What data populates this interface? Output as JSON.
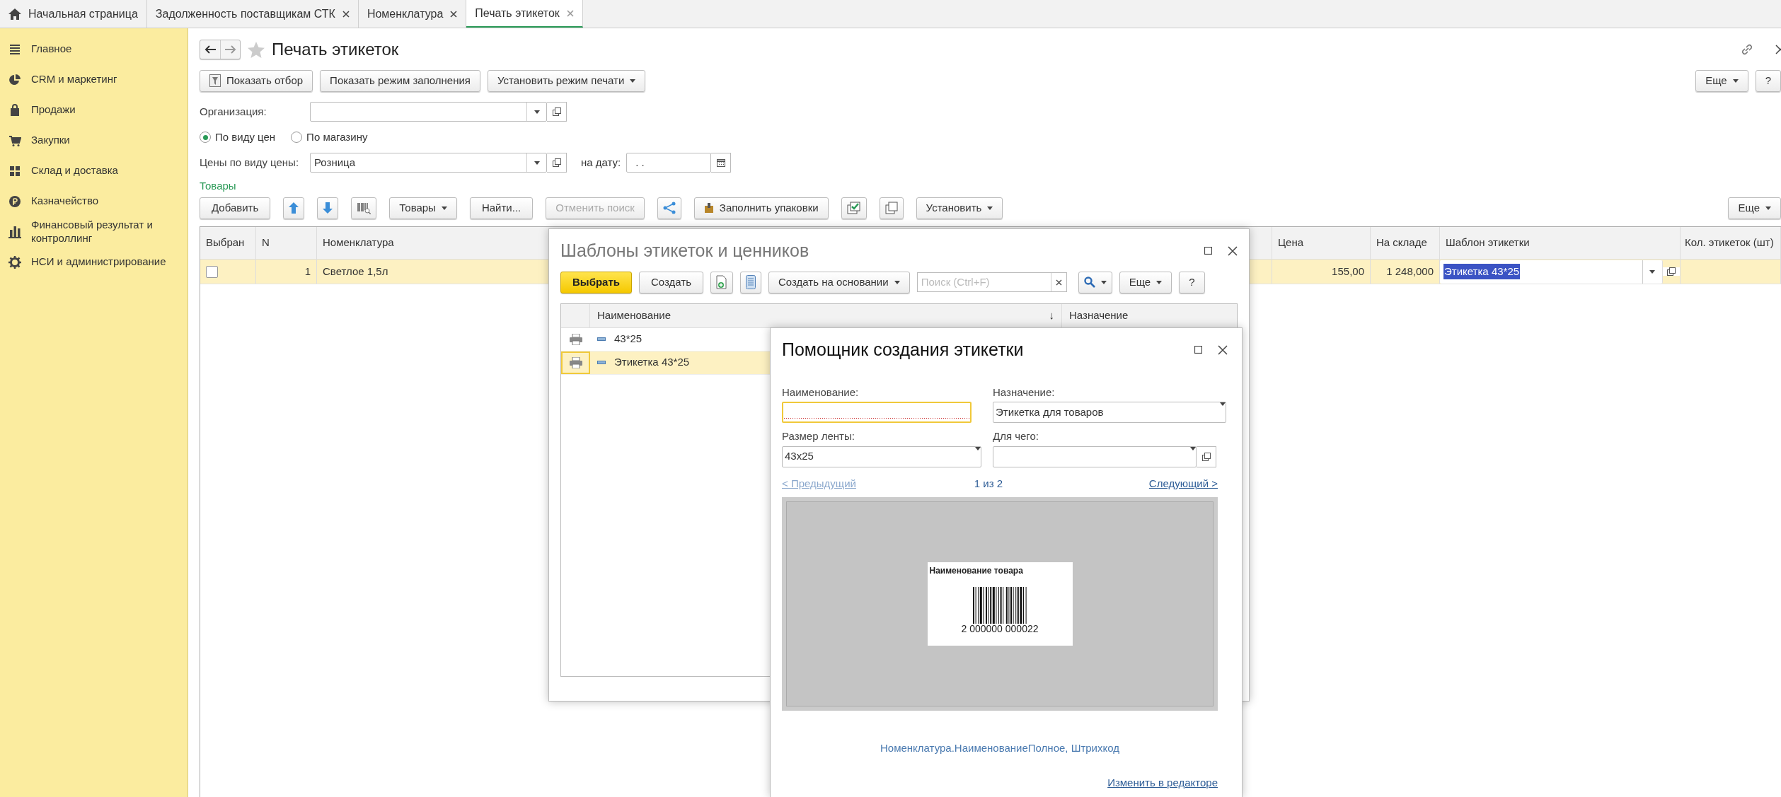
{
  "tabs": [
    {
      "label": "Начальная страница",
      "kind": "home",
      "selected": false
    },
    {
      "label": "Задолженность поставщикам СТК",
      "kind": "closable",
      "selected": false
    },
    {
      "label": "Номенклатура",
      "kind": "closable",
      "selected": false
    },
    {
      "label": "Печать этикеток",
      "kind": "closable",
      "selected": true
    }
  ],
  "sidebar": {
    "items": [
      {
        "label": "Главное"
      },
      {
        "label": "CRM и маркетинг"
      },
      {
        "label": "Продажи"
      },
      {
        "label": "Закупки"
      },
      {
        "label": "Склад и доставка"
      },
      {
        "label": "Казначейство"
      },
      {
        "label": "Финансовый результат и контроллинг"
      },
      {
        "label": "НСИ и администрирование"
      }
    ]
  },
  "form": {
    "title": "Печать этикеток",
    "toolbar": [
      {
        "kind": "icon",
        "label": "Показать отбор"
      },
      {
        "kind": "plain",
        "label": "Показать режим заполнения"
      },
      {
        "kind": "dropdown",
        "label": "Установить режим печати"
      }
    ],
    "more": "Еще",
    "help": "?",
    "organization": {
      "label": "Организация:"
    },
    "price_mode": [
      {
        "label": "По виду цен",
        "selected": true
      },
      {
        "label": "По магазину",
        "selected": false
      }
    ],
    "price_type": {
      "label": "Цены по виду цены:",
      "value": "Розница"
    },
    "date": {
      "label": "на дату:",
      "value": ". ."
    },
    "section": "Товары",
    "items_toolbar": [
      {
        "kind": "button",
        "label": "Добавить",
        "disabled": false
      },
      {
        "kind": "up",
        "disabled": false
      },
      {
        "kind": "down",
        "disabled": false
      },
      {
        "kind": "barcode",
        "disabled": false
      },
      {
        "kind": "dropdown",
        "label": "Товары",
        "disabled": false
      },
      {
        "kind": "button",
        "label": "Найти...",
        "disabled": false
      },
      {
        "kind": "button",
        "label": "Отменить поиск",
        "disabled": true
      },
      {
        "kind": "share",
        "disabled": false
      },
      {
        "kind": "package",
        "label": "Заполнить упаковки",
        "disabled": false
      },
      {
        "kind": "check",
        "disabled": false
      },
      {
        "kind": "copy",
        "disabled": false
      },
      {
        "kind": "dropdown",
        "label": "Установить",
        "disabled": false
      }
    ],
    "items_more": "Еще",
    "table": {
      "columns": [
        {
          "label": "Выбран"
        },
        {
          "label": "N"
        },
        {
          "label": "Номенклатура"
        },
        {
          "label": "Цена"
        },
        {
          "label": "На складе"
        },
        {
          "label": "Шаблон этикетки"
        },
        {
          "label": "Кол. этикеток (шт)"
        }
      ],
      "rows": [
        {
          "checked": false,
          "n": "1",
          "name": "Светлое 1,5л",
          "price": "155,00",
          "stock": "1 248,000",
          "template": "Этикетка 43*25",
          "selected": true
        }
      ]
    }
  },
  "templates_dialog": {
    "title": "Шаблоны этикеток и ценников",
    "toolbar": [
      {
        "kind": "primary",
        "label": "Выбрать"
      },
      {
        "kind": "button",
        "label": "Создать"
      },
      {
        "kind": "new-doc"
      },
      {
        "kind": "list"
      },
      {
        "kind": "dropdown",
        "label": "Создать на основании"
      }
    ],
    "search": {
      "placeholder": "Поиск (Ctrl+F)"
    },
    "more": "Еще",
    "help": "?",
    "columns": [
      {
        "label": "Наименование",
        "sort": "↓"
      },
      {
        "label": "Назначение"
      }
    ],
    "rows": [
      {
        "name": "43*25",
        "selected": false
      },
      {
        "name": "Этикетка 43*25",
        "selected": true
      }
    ]
  },
  "wizard": {
    "title": "Помощник создания этикетки",
    "fields": [
      {
        "label": "Наименование:",
        "kind": "text",
        "focused": true
      },
      {
        "label": "Назначение:",
        "kind": "select",
        "value": "Этикетка для товаров",
        "focused": false
      },
      {
        "label": "Размер ленты:",
        "kind": "select",
        "value": "43x25",
        "focused": false
      },
      {
        "label": "Для чего:",
        "kind": "select-open",
        "focused": false
      }
    ],
    "prev": {
      "label": "< Предыдущий",
      "disabled": true
    },
    "counter": "1 из 2",
    "next": {
      "label": "Следующий >",
      "disabled": false
    },
    "preview": {
      "product": "Наименование товара",
      "barcode": "2 000000 000022"
    },
    "fields_used": "Номенклатура.НаименованиеПолное, Штрихкод",
    "edit_link": "Изменить в редакторе"
  }
}
